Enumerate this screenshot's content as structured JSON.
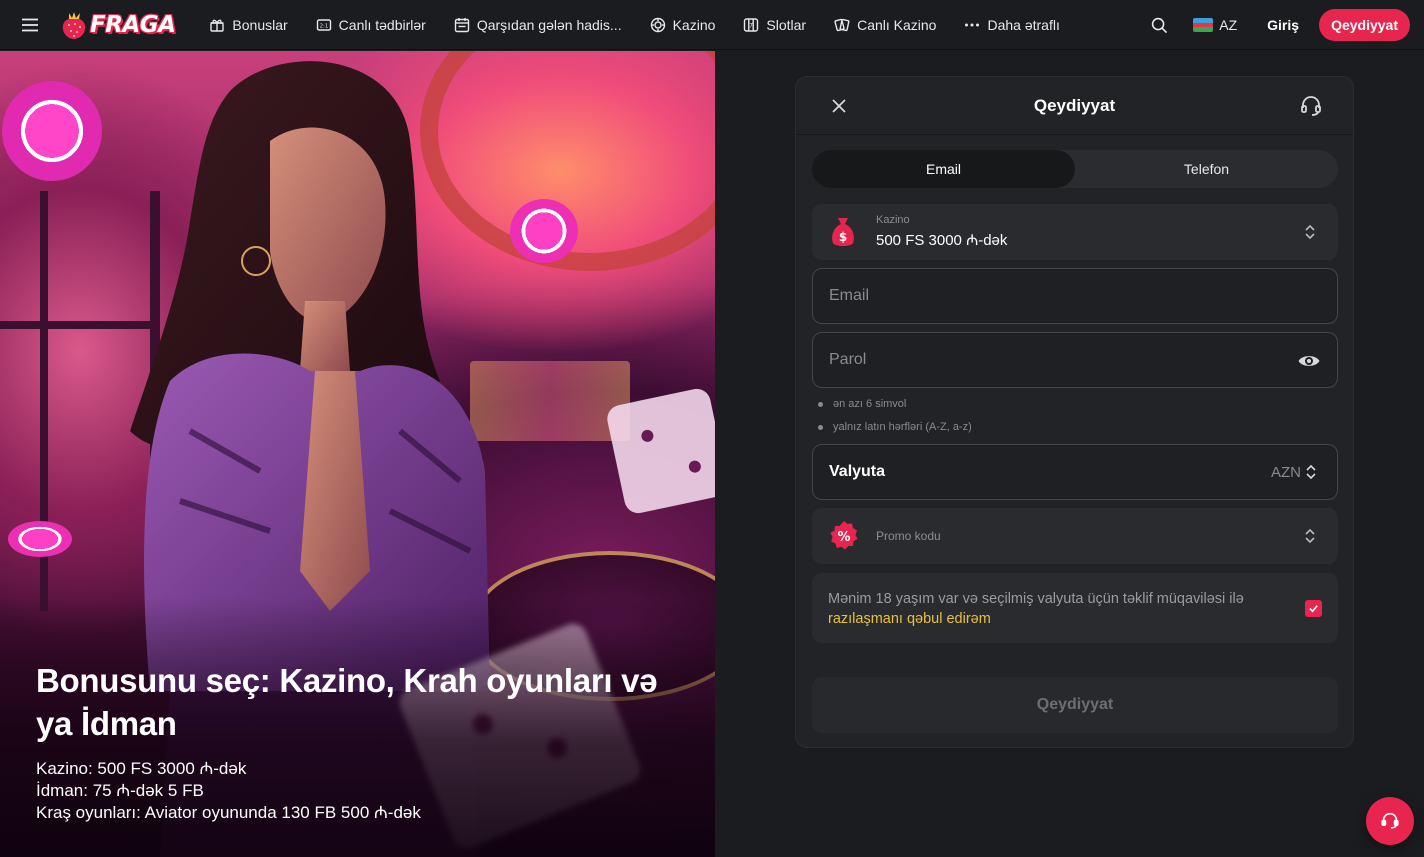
{
  "brand": {
    "name": "FRAGA",
    "accent": "#e8254e"
  },
  "nav": {
    "items": [
      {
        "label": "Bonuslar",
        "icon": "gift-icon"
      },
      {
        "label": "Canlı tədbirlər",
        "icon": "live-score-icon"
      },
      {
        "label": "Qarşıdan gələn hadis...",
        "icon": "calendar-icon"
      },
      {
        "label": "Kazino",
        "icon": "casino-chip-icon"
      },
      {
        "label": "Slotlar",
        "icon": "slot-machine-icon"
      },
      {
        "label": "Canlı Kazino",
        "icon": "playing-cards-icon"
      },
      {
        "label": "Daha ətraflı",
        "icon": "more-dots-icon"
      }
    ],
    "language": "AZ",
    "login": "Giriş",
    "register": "Qeydiyyat"
  },
  "hero": {
    "title": "Bonusunu seç: Kazino, Krah oyunları və ya İdman",
    "lines": [
      "Kazino: 500 FS 3000 ₼-dək",
      "İdman: 75 ₼-dək 5 FB",
      "Kraş oyunları: Aviator oyununda 130 FB 500 ₼-dək"
    ]
  },
  "form": {
    "title": "Qeydiyyat",
    "tabs": [
      {
        "label": "Email",
        "active": true
      },
      {
        "label": "Telefon",
        "active": false
      }
    ],
    "bonus": {
      "label": "Kazino",
      "value": "500 FS 3000 ₼-dək"
    },
    "email_placeholder": "Email",
    "password_placeholder": "Parol",
    "password_hints": [
      "ən azı 6 simvol",
      "yalnız latın hərfləri (A-Z, a-z)"
    ],
    "currency": {
      "label": "Valyuta",
      "value": "AZN"
    },
    "promo": {
      "label": "Promo kodu"
    },
    "agreement": {
      "text": "Mənim 18 yaşım var və seçilmiş valyuta üçün təklif müqaviləsi ilə",
      "link": "razılaşmanı qəbul edirəm",
      "checked": true
    },
    "submit": "Qeydiyyat"
  },
  "colors": {
    "background": "#1b1c1f",
    "panel": "#222326",
    "accent": "#e8254e",
    "link": "#e9c13a"
  }
}
